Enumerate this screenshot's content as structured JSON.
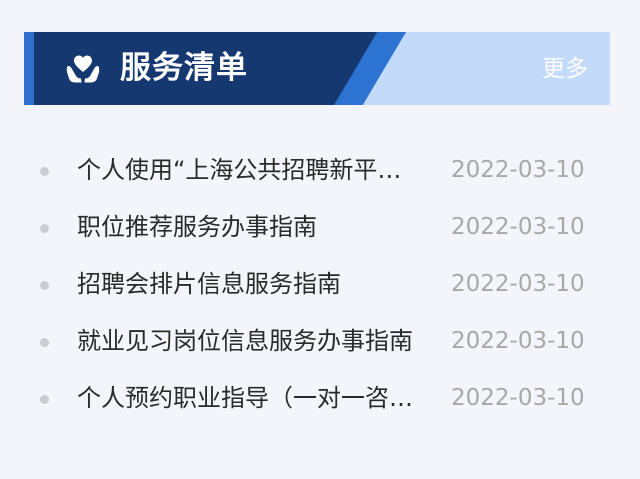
{
  "header": {
    "title": "服务清单",
    "more_label": "更多",
    "icon": "hands-heart-icon"
  },
  "items": [
    {
      "title": "个人使用“上海公共招聘新平…",
      "date": "2022-03-10"
    },
    {
      "title": "职位推荐服务办事指南",
      "date": "2022-03-10"
    },
    {
      "title": "招聘会排片信息服务指南",
      "date": "2022-03-10"
    },
    {
      "title": "就业见习岗位信息服务办事指南",
      "date": "2022-03-10"
    },
    {
      "title": "个人预约职业指导（一对一咨…",
      "date": "2022-03-10"
    }
  ],
  "colors": {
    "header_dark": "#14386f",
    "header_accent": "#2c73d2",
    "header_light": "#c3dafa",
    "background": "#f3f5fa",
    "title_text": "#2a2a2a",
    "date_text": "#a8a8a8"
  }
}
